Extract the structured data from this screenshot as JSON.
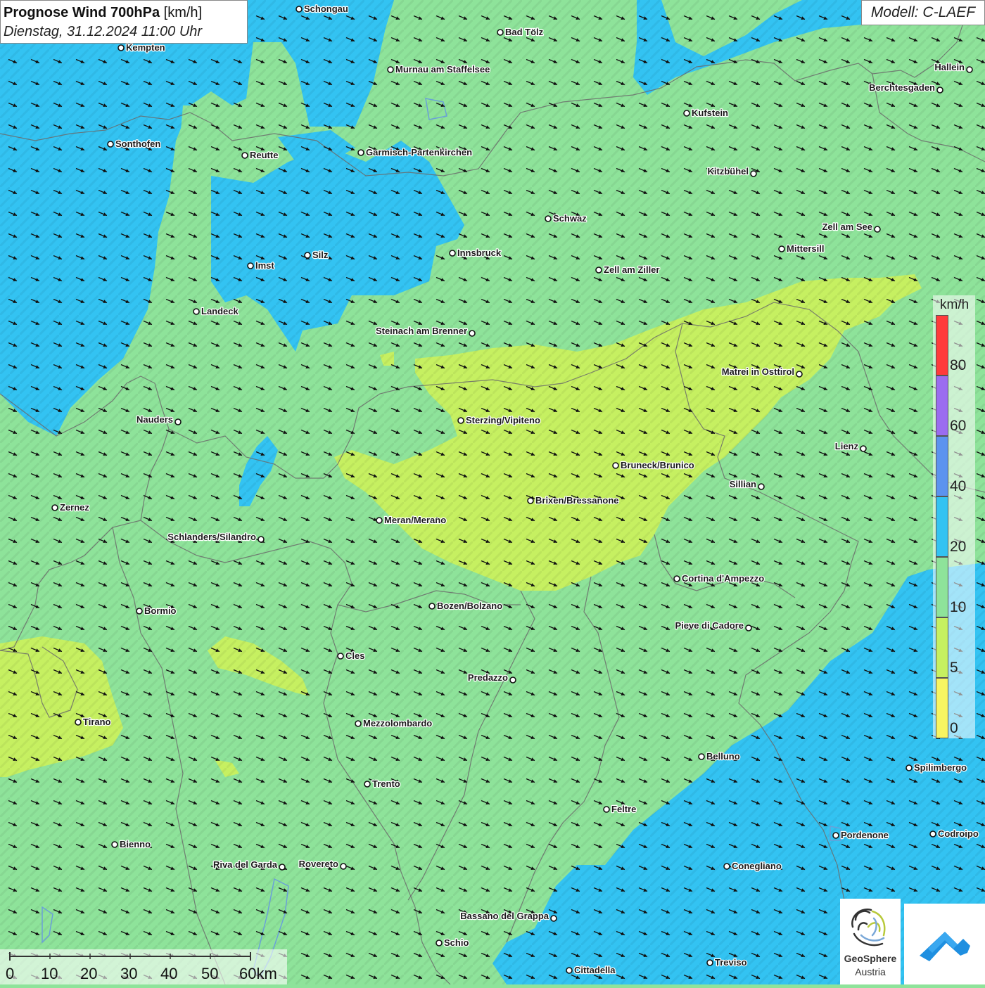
{
  "title": {
    "main": "Prognose Wind 700hPa",
    "unit": "[km/h]",
    "datetime": "Dienstag, 31.12.2024 11:00 Uhr"
  },
  "model": "Modell: C-LAEF",
  "legend": {
    "unit": "km/h",
    "ticks": [
      "80",
      "60",
      "40",
      "20",
      "10",
      "5",
      "0"
    ],
    "colors": [
      "#ff3b3b",
      "#9b6cf0",
      "#5c93ef",
      "#33c3f2",
      "#8ee39a",
      "#c6f061",
      "#f7f562"
    ]
  },
  "scalebar": {
    "ticks": [
      "0",
      "10",
      "20",
      "30",
      "40",
      "50",
      "60km"
    ]
  },
  "logo": {
    "name_bold": "GeoSphere",
    "name_sub": "Austria",
    "emblem": "geosphere-fingerprint-icon",
    "app_icon": "weather-app-icon"
  },
  "wind": {
    "dominant_direction": "west-northwest",
    "description": "flow toward east-southeast"
  },
  "cities": [
    {
      "id": "schongau",
      "name": "Schongau"
    },
    {
      "id": "bad-toelz",
      "name": "Bad Tölz"
    },
    {
      "id": "kempten",
      "name": "Kempten"
    },
    {
      "id": "murnau",
      "name": "Murnau am Staffelsee"
    },
    {
      "id": "hallein",
      "name": "Hallein"
    },
    {
      "id": "berchtesgaden",
      "name": "Berchtesgaden"
    },
    {
      "id": "kufstein",
      "name": "Kufstein"
    },
    {
      "id": "sonthofen",
      "name": "Sonthofen"
    },
    {
      "id": "reutte",
      "name": "Reutte"
    },
    {
      "id": "garmisch",
      "name": "Garmisch-Partenkirchen"
    },
    {
      "id": "kitzbuehel",
      "name": "Kitzbühel"
    },
    {
      "id": "schwaz",
      "name": "Schwaz"
    },
    {
      "id": "zell-am-see",
      "name": "Zell am See"
    },
    {
      "id": "mittersill",
      "name": "Mittersill"
    },
    {
      "id": "innsbruck",
      "name": "Innsbruck"
    },
    {
      "id": "silz",
      "name": "Silz"
    },
    {
      "id": "imst",
      "name": "Imst"
    },
    {
      "id": "zell-am-ziller",
      "name": "Zell am Ziller"
    },
    {
      "id": "landeck",
      "name": "Landeck"
    },
    {
      "id": "steinach",
      "name": "Steinach am Brenner"
    },
    {
      "id": "matrei",
      "name": "Matrei in Osttirol"
    },
    {
      "id": "nauders",
      "name": "Nauders"
    },
    {
      "id": "sterzing",
      "name": "Sterzing/Vipiteno"
    },
    {
      "id": "lienz",
      "name": "Lienz"
    },
    {
      "id": "bruneck",
      "name": "Bruneck/Brunico"
    },
    {
      "id": "sillian",
      "name": "Sillian"
    },
    {
      "id": "brixen",
      "name": "Brixen/Bressanone"
    },
    {
      "id": "zernez",
      "name": "Zernez"
    },
    {
      "id": "meran",
      "name": "Meran/Merano"
    },
    {
      "id": "schlanders",
      "name": "Schlanders/Silandro"
    },
    {
      "id": "cortina",
      "name": "Cortina d'Ampezzo"
    },
    {
      "id": "bozen",
      "name": "Bozen/Bolzano"
    },
    {
      "id": "bormio",
      "name": "Bormio"
    },
    {
      "id": "pieve",
      "name": "Pieve di Cadore"
    },
    {
      "id": "cles",
      "name": "Cles"
    },
    {
      "id": "predazzo",
      "name": "Predazzo"
    },
    {
      "id": "tirano",
      "name": "Tirano"
    },
    {
      "id": "mezzolombardo",
      "name": "Mezzolombardo"
    },
    {
      "id": "belluno",
      "name": "Belluno"
    },
    {
      "id": "spilimbergo",
      "name": "Spilimbergo"
    },
    {
      "id": "trento",
      "name": "Trento"
    },
    {
      "id": "feltre",
      "name": "Feltre"
    },
    {
      "id": "pordenone",
      "name": "Pordenone"
    },
    {
      "id": "codroipo",
      "name": "Codroipo"
    },
    {
      "id": "bienno",
      "name": "Bienno"
    },
    {
      "id": "riva",
      "name": "Riva del Garda"
    },
    {
      "id": "rovereto",
      "name": "Rovereto"
    },
    {
      "id": "conegliano",
      "name": "Conegliano"
    },
    {
      "id": "bassano",
      "name": "Bassano del Grappa"
    },
    {
      "id": "schio",
      "name": "Schio"
    },
    {
      "id": "treviso",
      "name": "Treviso"
    },
    {
      "id": "cittadella",
      "name": "Cittadella"
    }
  ]
}
